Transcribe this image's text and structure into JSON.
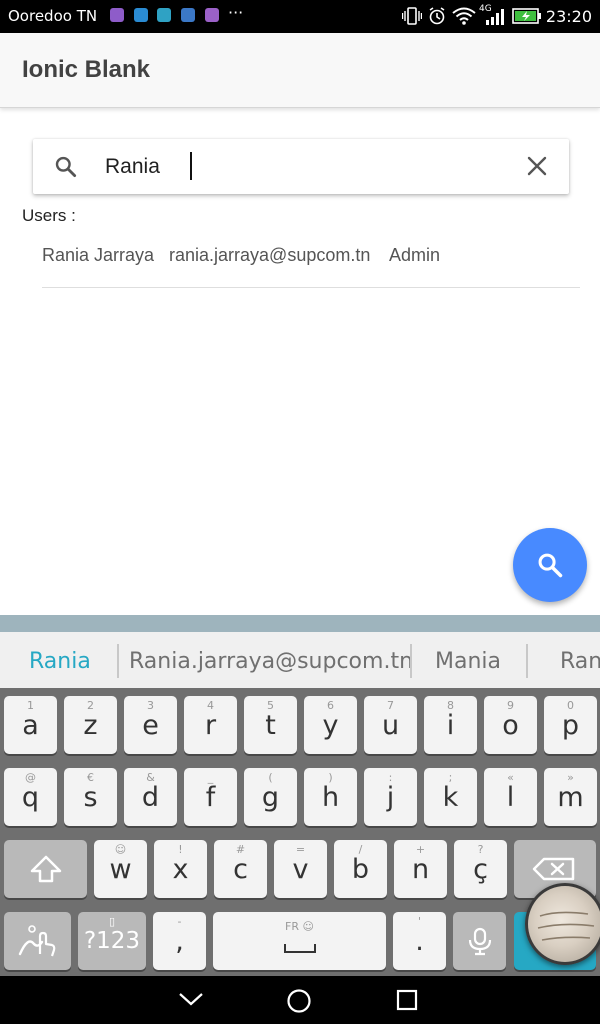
{
  "status_bar": {
    "carrier": "Ooredoo TN",
    "more": "···",
    "network": "4G",
    "time": "23:20"
  },
  "header": {
    "title": "Ionic Blank"
  },
  "search": {
    "value": "Rania"
  },
  "users_label": "Users :",
  "users": [
    {
      "name": "Rania Jarraya",
      "email": "rania.jarraya@supcom.tn",
      "role": "Admin"
    }
  ],
  "keyboard": {
    "suggestions": [
      "Rania",
      "Rania.jarraya@supcom.tn",
      "Mania",
      "Ran"
    ],
    "accent_color": "#26a8c4",
    "row1": [
      {
        "main": "a",
        "sub": "1"
      },
      {
        "main": "z",
        "sub": "2"
      },
      {
        "main": "e",
        "sub": "3"
      },
      {
        "main": "r",
        "sub": "4"
      },
      {
        "main": "t",
        "sub": "5"
      },
      {
        "main": "y",
        "sub": "6"
      },
      {
        "main": "u",
        "sub": "7"
      },
      {
        "main": "i",
        "sub": "8"
      },
      {
        "main": "o",
        "sub": "9"
      },
      {
        "main": "p",
        "sub": "0"
      }
    ],
    "row2": [
      {
        "main": "q",
        "sub": "@"
      },
      {
        "main": "s",
        "sub": "€"
      },
      {
        "main": "d",
        "sub": "&"
      },
      {
        "main": "f",
        "sub": "_"
      },
      {
        "main": "g",
        "sub": "("
      },
      {
        "main": "h",
        "sub": ")"
      },
      {
        "main": "j",
        "sub": ":"
      },
      {
        "main": "k",
        "sub": ";"
      },
      {
        "main": "l",
        "sub": "«"
      },
      {
        "main": "m",
        "sub": "»"
      }
    ],
    "row3": [
      {
        "main": "w",
        "sub": "☺"
      },
      {
        "main": "x",
        "sub": "!"
      },
      {
        "main": "c",
        "sub": "#"
      },
      {
        "main": "v",
        "sub": "="
      },
      {
        "main": "b",
        "sub": "/"
      },
      {
        "main": "n",
        "sub": "+"
      },
      {
        "main": "ç",
        "sub": "?"
      }
    ],
    "symbols_label": "?123",
    "comma": {
      "main": ",",
      "sub": "-"
    },
    "space_label": "FR ☺",
    "period": {
      "main": ".",
      "sub": "'"
    }
  },
  "colors": {
    "fab": "#488aff",
    "header_bg": "#f8f8f8"
  }
}
